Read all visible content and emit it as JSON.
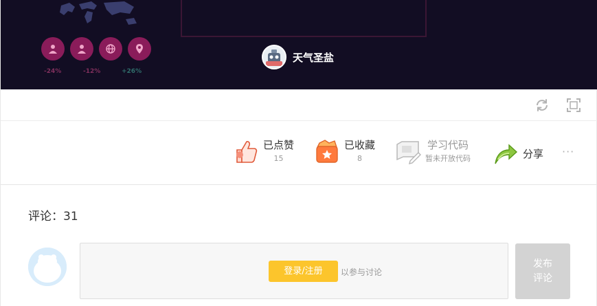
{
  "preview": {
    "author_name": "天气圣盐",
    "stats": [
      "-24%",
      "-12%",
      "+26%"
    ]
  },
  "toolbar": {
    "refresh_icon": "refresh-icon",
    "fullscreen_icon": "fullscreen-icon"
  },
  "actions": {
    "like": {
      "label": "已点赞",
      "count": "15"
    },
    "collect": {
      "label": "已收藏",
      "count": "8"
    },
    "code": {
      "label": "学习代码",
      "sub": "暂未开放代码"
    },
    "share": {
      "label": "分享"
    },
    "more": "···"
  },
  "comments": {
    "count_label": "评论：31",
    "login_label": "登录/注册",
    "join_text": "以参与讨论",
    "publish_line1": "发布",
    "publish_line2": "评论"
  },
  "colors": {
    "banner_bg": "#120d23",
    "accent_yellow": "#fcc52c",
    "publish_disabled": "#d3d3d3"
  }
}
